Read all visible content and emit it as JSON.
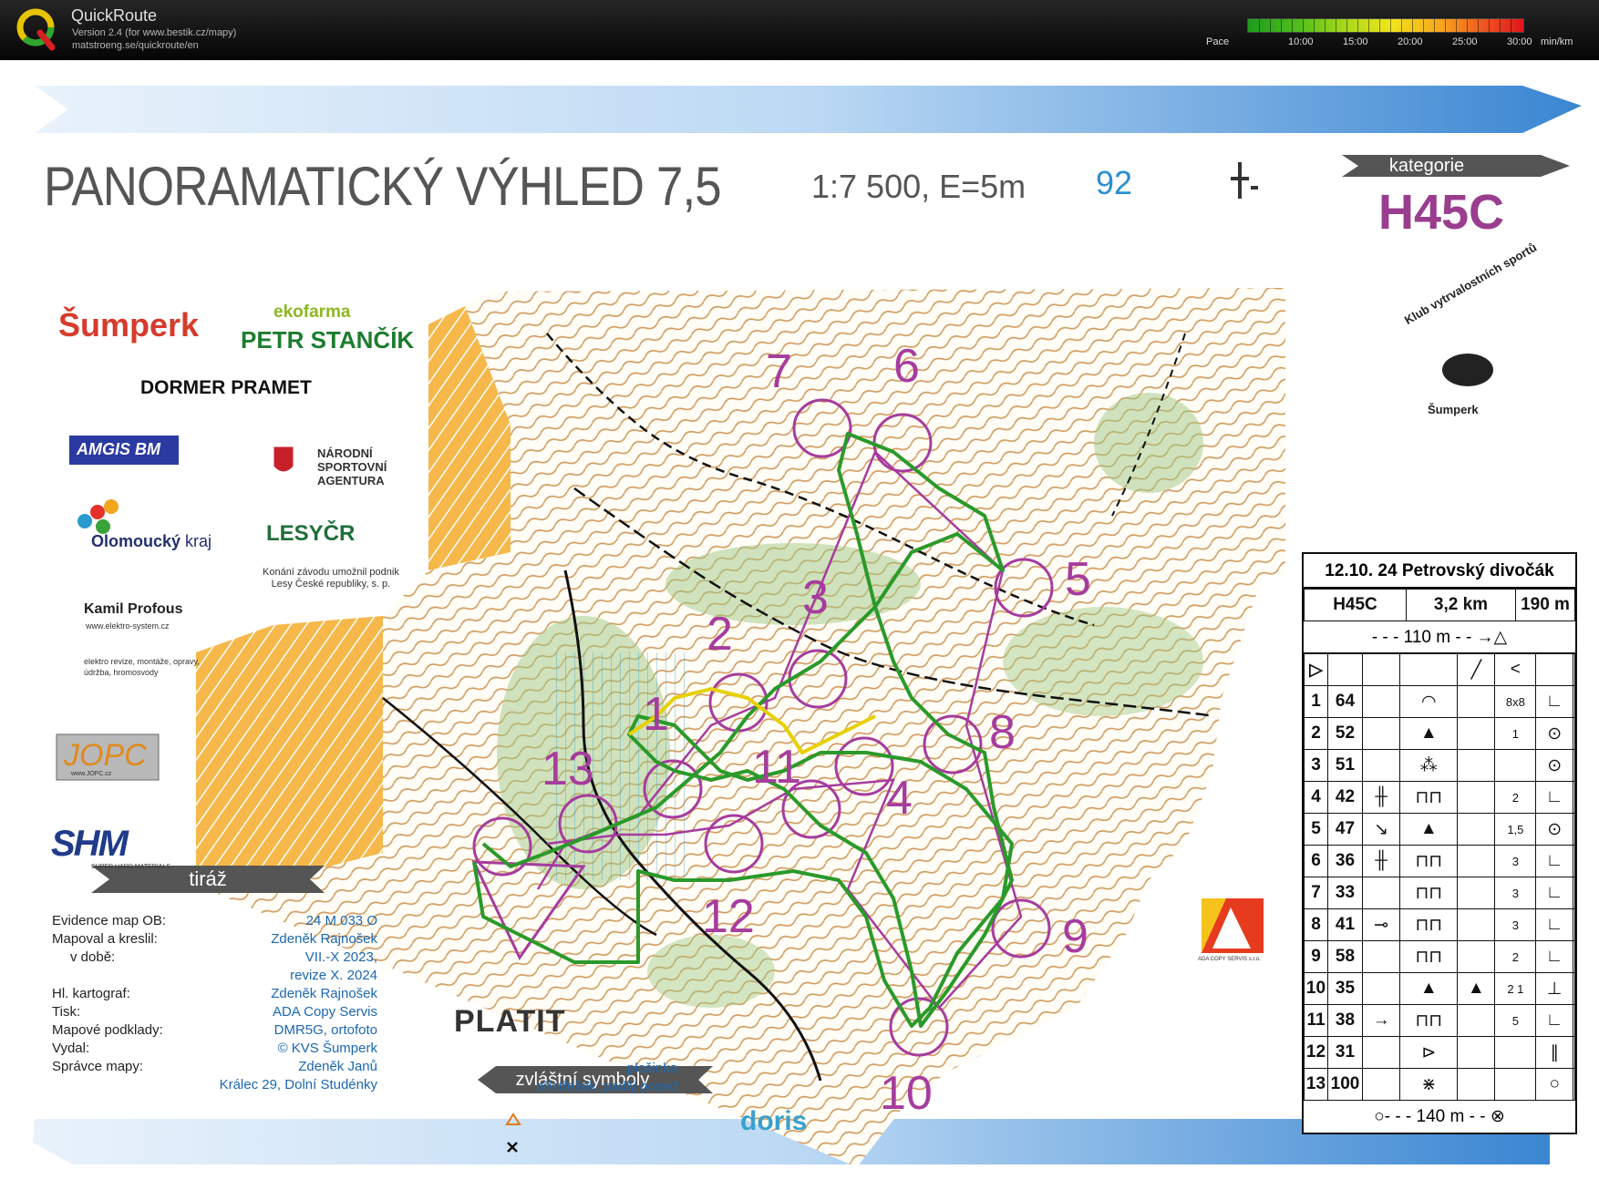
{
  "app": {
    "title": "QuickRoute",
    "version": "Version 2.4  (for www.bestik.cz/mapy)",
    "url": "matstroeng.se/quickroute/en",
    "logo_letter": "Q"
  },
  "pace": {
    "label": "Pace",
    "ticks": [
      "10:00",
      "15:00",
      "20:00",
      "25:00",
      "30:00"
    ],
    "unit": "min/km",
    "colors": [
      "#1d9b1d",
      "#a6d81a",
      "#f1e51c",
      "#f6a61c",
      "#e0141c"
    ]
  },
  "map": {
    "title": "PANORAMATICKÝ VÝHLED 7,5",
    "scale": "1:7 500, E=5m",
    "number": "92",
    "category_label": "kategorie",
    "category": "H45C",
    "controls": [
      "1",
      "2",
      "3",
      "4",
      "5",
      "6",
      "7",
      "8",
      "9",
      "10",
      "11",
      "12",
      "13"
    ]
  },
  "sponsors": {
    "sumperk": "Šumperk",
    "ekofarma": "ekofarma",
    "stancik": "PETR STANČÍK",
    "dormer": "DORMER",
    "pramet": "PRAMET",
    "amgis": "AMGIS BM",
    "nsa": [
      "NÁRODNÍ",
      "SPORTOVNÍ",
      "AGENTURA"
    ],
    "olomoucky": "Olomoucký",
    "kraj": "kraj",
    "lesycr": "LESYČR",
    "lesy_note": [
      "Konání závodu umožnil podnik",
      "Lesy České republiky, s. p."
    ],
    "kamil": "Kamil Profous",
    "kamil_web": "www.elektro-system.cz",
    "kamil_desc": [
      "elektro revize, montáže, opravy,",
      "údržba, hromosvody"
    ],
    "jopc": "JOPC",
    "jopc_web": "www.JOPC.cz",
    "shm": "SHM",
    "shm_sub": "SUPER HARD MATERIALS",
    "platit": "PLATIT",
    "doris": "doris",
    "ada": "ADA COPY SERVIS s.r.o.",
    "club": [
      "Klub vytrvalostních sportů",
      "Šumperk"
    ]
  },
  "imprint": {
    "title": "tiráž",
    "rows": [
      {
        "k": "Evidence map OB:",
        "v": "24 M 033 O"
      },
      {
        "k": "Mapoval a kreslil:",
        "v": "Zdeněk Rajnošek"
      },
      {
        "k": "v době:",
        "v": "VII.-X 2023,"
      },
      {
        "k": "",
        "v": "revize X. 2024"
      },
      {
        "k": "Hl. kartograf:",
        "v": "Zdeněk Rajnošek"
      },
      {
        "k": "Tisk:",
        "v": "ADA Copy Servis"
      },
      {
        "k": "Mapové podklady:",
        "v": "DMR5G, ortofoto"
      },
      {
        "k": "Vydal:",
        "v": "© KVS Šumperk"
      },
      {
        "k": "Správce mapy:",
        "v": "Zdeněk Janů"
      },
      {
        "k": "",
        "v": "Králec 29, Dolní Studénky"
      }
    ]
  },
  "special_symbols": {
    "title": "zvláštní symboly",
    "items": [
      {
        "symbol": "△",
        "label": "plošinka"
      },
      {
        "symbol": "✕",
        "label": "přístřešek, padlý posed"
      }
    ]
  },
  "description": {
    "event": "12.10. 24 Petrovský divočák",
    "category": "H45C",
    "length": "3,2 km",
    "climb": "190 m",
    "start_leg": "110 m",
    "finish_leg": "140 m",
    "controls": [
      {
        "n": "1",
        "code": "64",
        "d": "",
        "e": "◠",
        "f": "",
        "g": "8x8",
        "h": "∟"
      },
      {
        "n": "2",
        "code": "52",
        "d": "",
        "e": "▲",
        "f": "",
        "g": "1",
        "h": "⊙"
      },
      {
        "n": "3",
        "code": "51",
        "d": "",
        "e": "⁂",
        "f": "",
        "g": "",
        "h": "⊙"
      },
      {
        "n": "4",
        "code": "42",
        "d": "╫",
        "e": "⊓⊓",
        "f": "",
        "g": "2",
        "h": "∟"
      },
      {
        "n": "5",
        "code": "47",
        "d": "↘",
        "e": "▲",
        "f": "",
        "g": "1,5",
        "h": "⊙"
      },
      {
        "n": "6",
        "code": "36",
        "d": "╫",
        "e": "⊓⊓",
        "f": "",
        "g": "3",
        "h": "∟"
      },
      {
        "n": "7",
        "code": "33",
        "d": "",
        "e": "⊓⊓",
        "f": "",
        "g": "3",
        "h": "∟"
      },
      {
        "n": "8",
        "code": "41",
        "d": "⊸",
        "e": "⊓⊓",
        "f": "",
        "g": "3",
        "h": "∟"
      },
      {
        "n": "9",
        "code": "58",
        "d": "",
        "e": "⊓⊓",
        "f": "",
        "g": "2",
        "h": "∟"
      },
      {
        "n": "10",
        "code": "35",
        "d": "",
        "e": "▲",
        "f": "▲",
        "g": "2 1",
        "h": "⊥"
      },
      {
        "n": "11",
        "code": "38",
        "d": "→",
        "e": "⊓⊓",
        "f": "",
        "g": "5",
        "h": "∟"
      },
      {
        "n": "12",
        "code": "31",
        "d": "",
        "e": "⊳",
        "f": "",
        "g": "",
        "h": "∥"
      },
      {
        "n": "13",
        "code": "100",
        "d": "",
        "e": "⋇",
        "f": "",
        "g": "",
        "h": "○"
      }
    ]
  }
}
